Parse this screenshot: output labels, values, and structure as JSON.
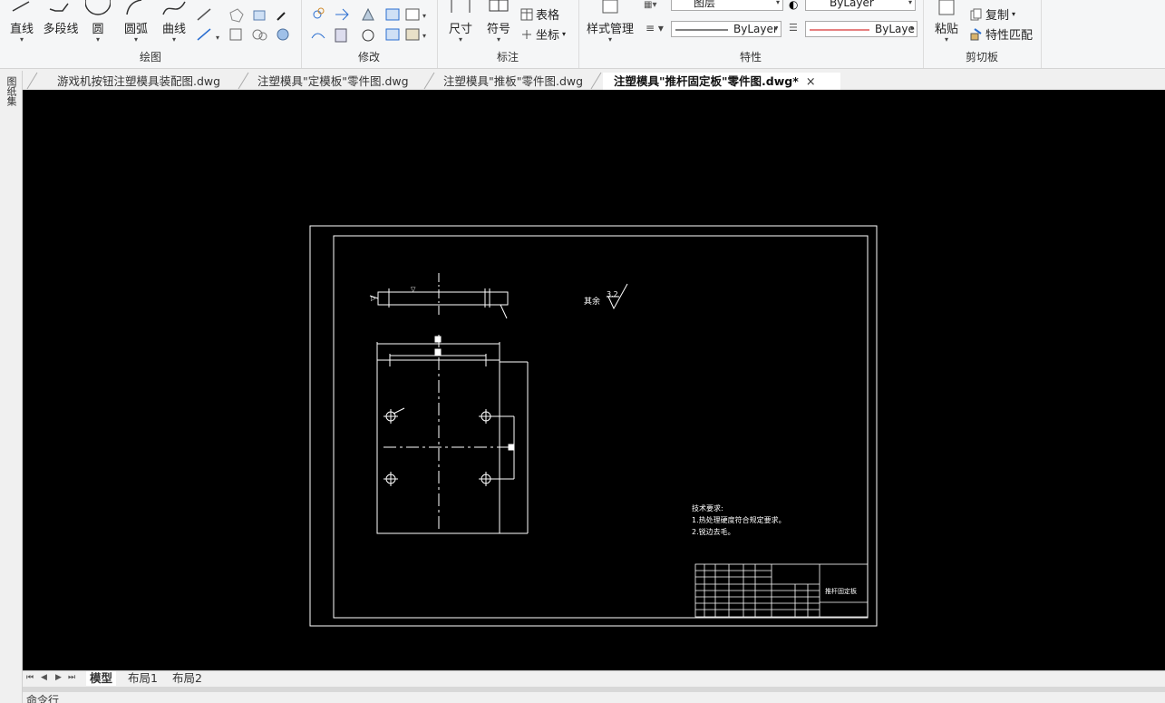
{
  "ribbon": {
    "draw_panel": {
      "title": "绘图",
      "buttons": [
        {
          "label": "直线",
          "icon": "line-icon"
        },
        {
          "label": "多段线",
          "icon": "polyline-icon"
        },
        {
          "label": "圆",
          "icon": "circle-icon"
        },
        {
          "label": "圆弧",
          "icon": "arc-icon"
        },
        {
          "label": "曲线",
          "icon": "spline-icon"
        }
      ]
    },
    "modify_panel": {
      "title": "修改"
    },
    "annotate_panel": {
      "title": "标注",
      "dimension_label": "尺寸",
      "symbol_label": "符号",
      "table_label": "表格",
      "coordinate_label": "坐标"
    },
    "properties_panel": {
      "title": "特性",
      "style_manager_label": "样式管理",
      "layer_value": "图层",
      "color_value": "ByLayer",
      "linetype_value": "ByLayer",
      "lineweight_value": "ByLaye"
    },
    "clipboard_panel": {
      "title": "剪切板",
      "paste_label": "粘贴",
      "copy_label": "复制",
      "match_label": "特性匹配"
    }
  },
  "left_strip": {
    "label": "图纸集"
  },
  "tabs": [
    {
      "label": "游戏机按钮注塑模具装配图.dwg",
      "active": false
    },
    {
      "label": "注塑模具\"定模板\"零件图.dwg",
      "active": false
    },
    {
      "label": "注塑模具\"推板\"零件图.dwg",
      "active": false
    },
    {
      "label": "注塑模具\"推杆固定板\"零件图.dwg*",
      "active": true
    }
  ],
  "tab_close": "×",
  "drawing": {
    "roughness_label": "其余",
    "roughness_value": "3.2",
    "tech_req_title": "技术要求:",
    "tech_req_1": "1.热处理硬度符合规定要求。",
    "tech_req_2": "2.锐边去毛。",
    "part_name": "推杆固定板"
  },
  "layout_tabs": [
    {
      "label": "模型",
      "active": true
    },
    {
      "label": "布局1",
      "active": false
    },
    {
      "label": "布局2",
      "active": false
    }
  ],
  "nav_buttons": [
    "⏮",
    "◀",
    "▶",
    "⏭"
  ],
  "command_line": "命令行"
}
